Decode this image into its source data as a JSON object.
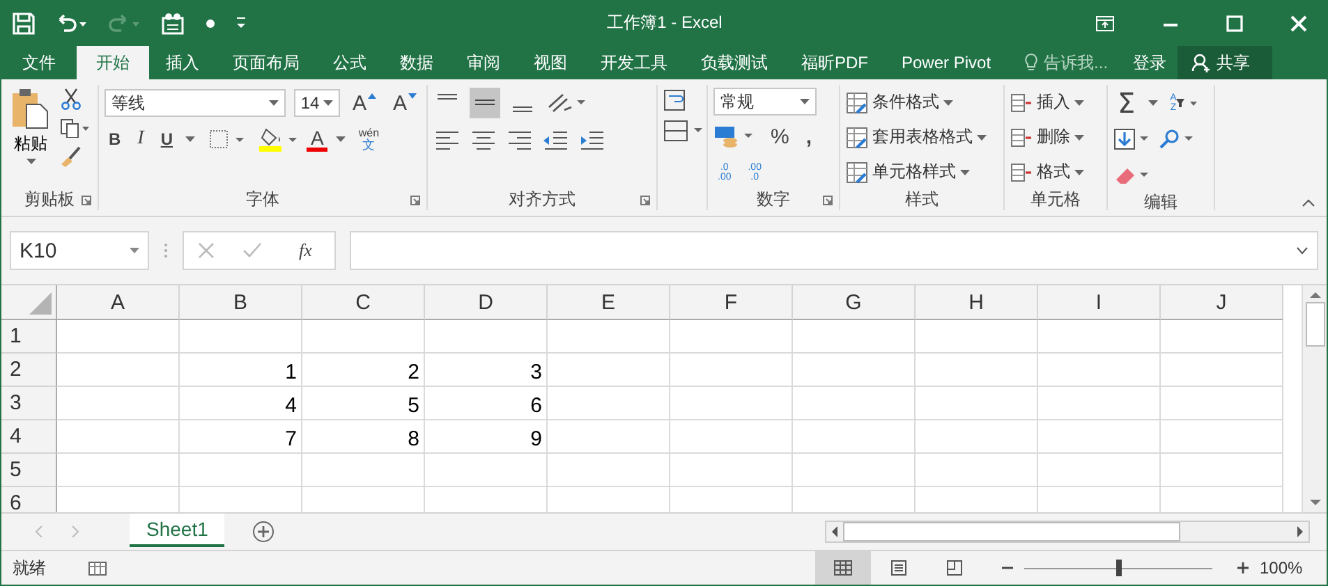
{
  "window": {
    "title": "工作簿1 - Excel"
  },
  "tabs": [
    {
      "label": "文件",
      "selected": false
    },
    {
      "label": "开始",
      "selected": true
    },
    {
      "label": "插入",
      "selected": false
    },
    {
      "label": "页面布局",
      "selected": false
    },
    {
      "label": "公式",
      "selected": false
    },
    {
      "label": "数据",
      "selected": false
    },
    {
      "label": "审阅",
      "selected": false
    },
    {
      "label": "视图",
      "selected": false
    },
    {
      "label": "开发工具",
      "selected": false
    },
    {
      "label": "负载测试",
      "selected": false
    },
    {
      "label": "福昕PDF",
      "selected": false
    },
    {
      "label": "Power Pivot",
      "selected": false
    }
  ],
  "tell_me": "告诉我...",
  "sign_in": "登录",
  "share": "共享",
  "clipboard": {
    "paste": "粘贴",
    "label": "剪贴板"
  },
  "font": {
    "name": "等线",
    "size": "14",
    "grow": "A",
    "shrink": "A",
    "bold": "B",
    "italic": "I",
    "underline": "U",
    "color_letter": "A",
    "pinyin": "wén",
    "pinyin_char": "文",
    "label": "字体"
  },
  "alignment": {
    "label": "对齐方式"
  },
  "number": {
    "format": "常规",
    "percent": "%",
    "comma": ",",
    "increase_decimal": [
      ".0",
      ".00"
    ],
    "decrease_decimal": [
      ".00",
      ".0"
    ],
    "label": "数字"
  },
  "styles": {
    "items": [
      "条件格式",
      "套用表格格式",
      "单元格样式"
    ],
    "label": "样式"
  },
  "cells": {
    "items": [
      "插入",
      "删除",
      "格式"
    ],
    "label": "单元格"
  },
  "editing": {
    "sum": "Σ",
    "sort": [
      "A",
      "Z"
    ],
    "label": "编辑"
  },
  "formula_bar": {
    "name_box": "K10",
    "fx": "fx"
  },
  "sheet": {
    "columns": [
      "A",
      "B",
      "C",
      "D",
      "E",
      "F",
      "G",
      "H",
      "I",
      "J"
    ],
    "rows": [
      {
        "label": "1",
        "cells": []
      },
      {
        "label": "2",
        "cells": [
          null,
          "1",
          "2",
          "3"
        ]
      },
      {
        "label": "3",
        "cells": [
          null,
          "4",
          "5",
          "6"
        ]
      },
      {
        "label": "4",
        "cells": [
          null,
          "7",
          "8",
          "9"
        ]
      },
      {
        "label": "5",
        "cells": []
      },
      {
        "label": "6",
        "cells": []
      }
    ]
  },
  "sheet_tabs": [
    {
      "label": "Sheet1",
      "selected": true
    }
  ],
  "status": {
    "text": "就绪",
    "zoom": "100%",
    "zoom_level": {
      "level": 0.5
    }
  }
}
